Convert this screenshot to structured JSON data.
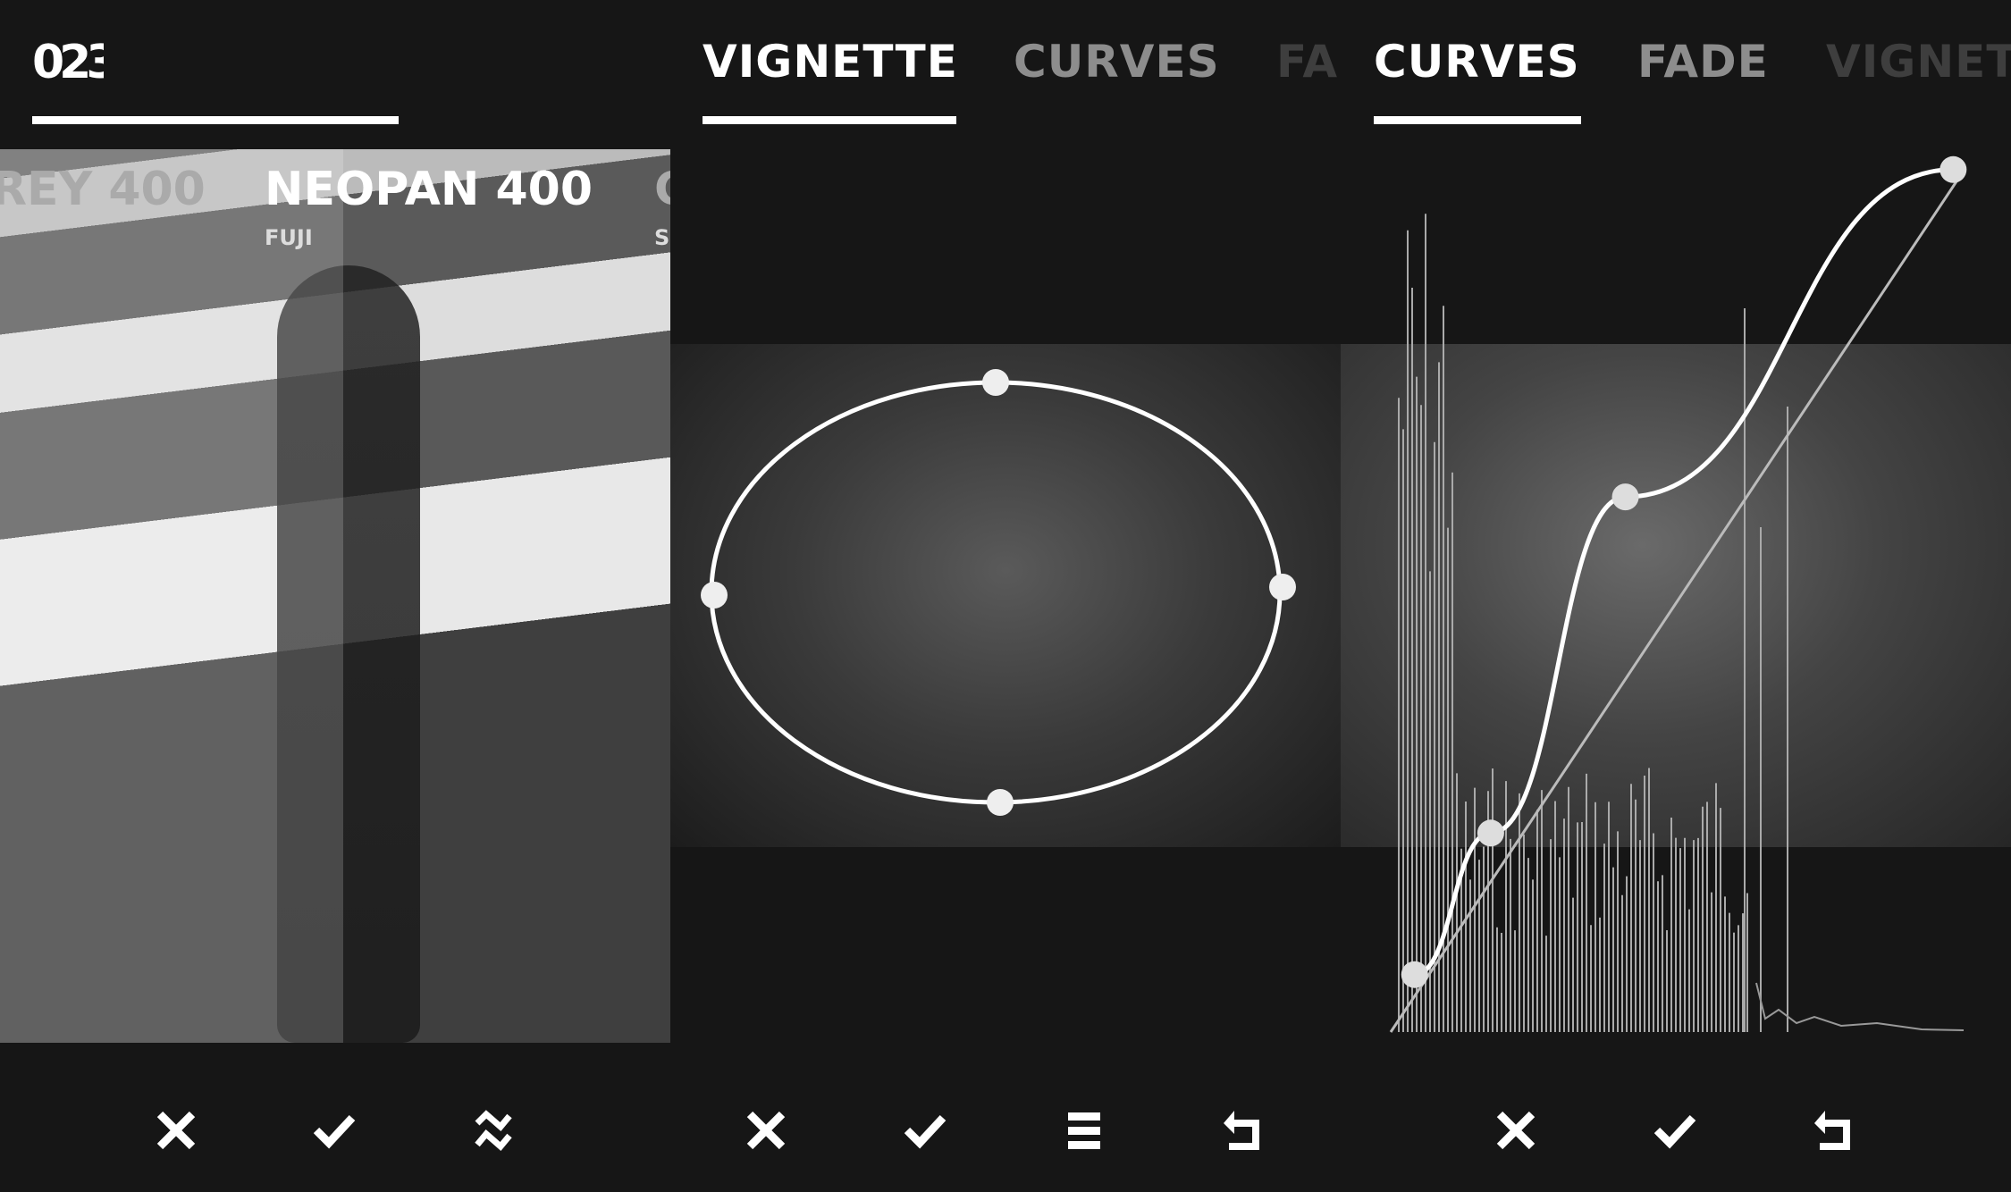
{
  "panel_film": {
    "counter": "023",
    "films": [
      {
        "name": "REY 400",
        "brand": ""
      },
      {
        "name": "NEOPAN 400",
        "brand": "FUJI"
      },
      {
        "name": "C",
        "brand": "S"
      }
    ],
    "toolbar": [
      "close-icon",
      "check-icon",
      "shuffle-icon"
    ]
  },
  "panel_vignette": {
    "tabs": [
      {
        "label": "VIGNETTE",
        "state": "active"
      },
      {
        "label": "CURVES",
        "state": "inactive"
      },
      {
        "label": "FA",
        "state": "faded"
      }
    ],
    "toolbar": [
      "close-icon",
      "check-icon",
      "menu-icon",
      "undo-icon"
    ]
  },
  "panel_curves": {
    "tabs": [
      {
        "label": "CURVES",
        "state": "active"
      },
      {
        "label": "FADE",
        "state": "inactive"
      },
      {
        "label": "VIGNET",
        "state": "faded"
      }
    ],
    "curve_points": [
      [
        0.05,
        0.07
      ],
      [
        0.18,
        0.23
      ],
      [
        0.41,
        0.61
      ],
      [
        0.97,
        0.98
      ]
    ],
    "toolbar": [
      "close-icon",
      "check-icon",
      "undo-icon"
    ]
  },
  "colors": {
    "background": "#161616",
    "active": "#ffffff",
    "inactive": "#8d8d8d",
    "faded": "#3e3e3e"
  }
}
